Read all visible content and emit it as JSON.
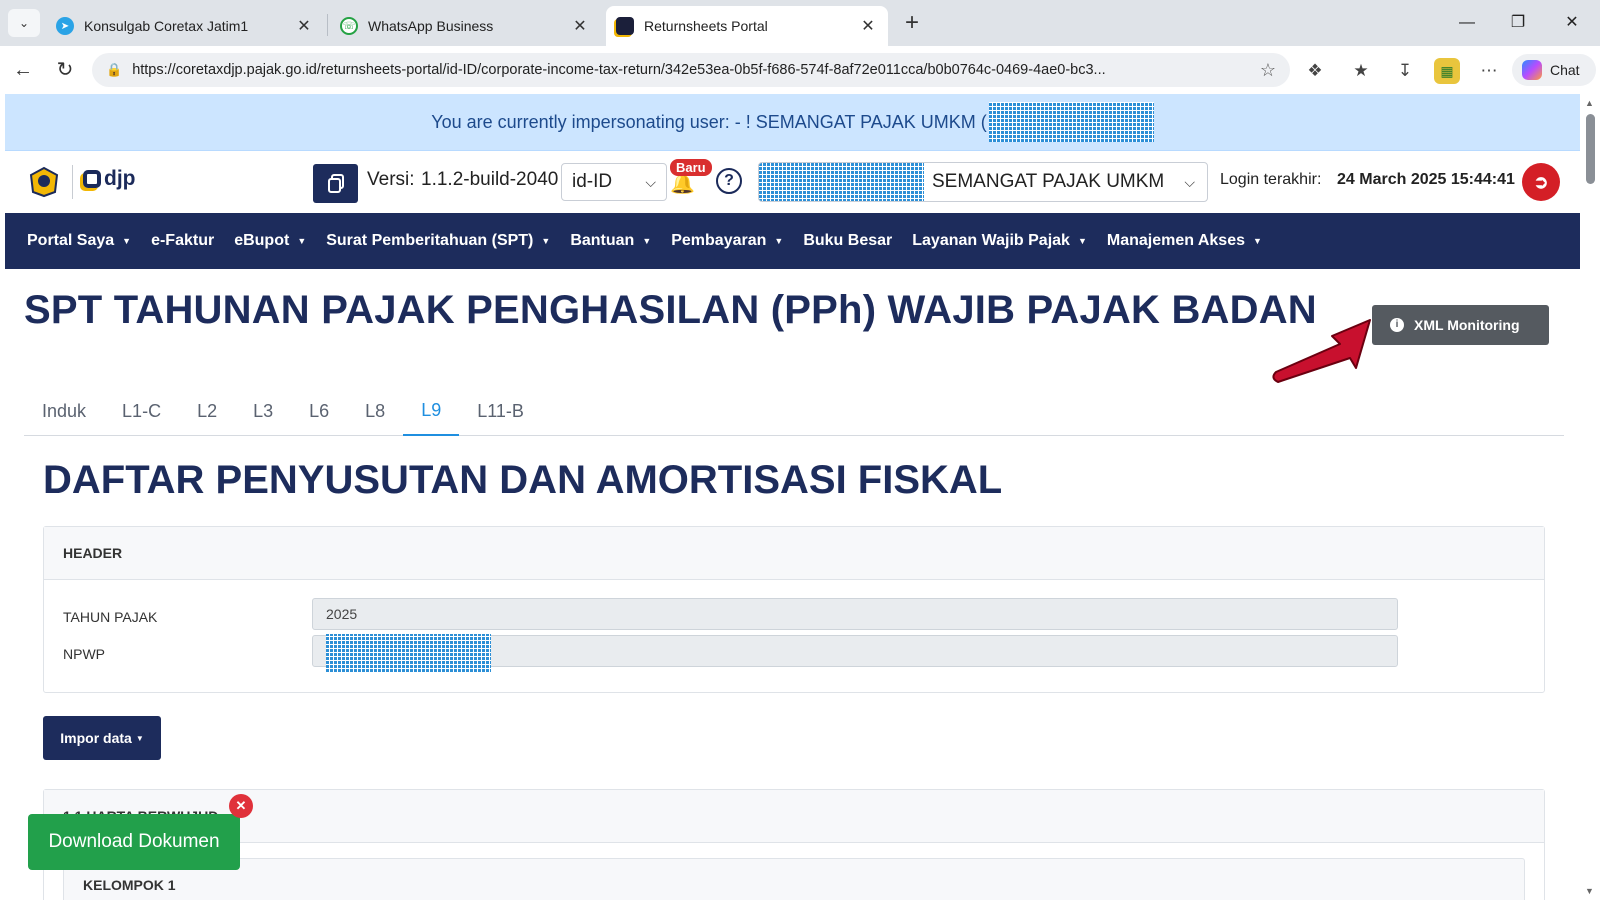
{
  "browser": {
    "tabs": [
      {
        "title": "Konsulgab Coretax Jatim1",
        "icon": "telegram-icon",
        "active": false
      },
      {
        "title": "WhatsApp Business",
        "icon": "whatsapp-icon",
        "active": false
      },
      {
        "title": "Returnsheets Portal",
        "icon": "portal-icon",
        "active": true
      }
    ],
    "url": "https://coretaxdjp.pajak.go.id/returnsheets-portal/id-ID/corporate-income-tax-return/342e53ea-0b5f-f686-574f-8af72e011cca/b0b0764c-0469-4ae0-bc3...",
    "chat_label": "Chat"
  },
  "banner": {
    "text": "You are currently impersonating user: - ! SEMANGAT PAJAK UMKM ("
  },
  "header": {
    "logo_text": "djp",
    "versi_label": "Versi:",
    "versi_value": "1.1.2-build-2040",
    "language": "id-ID",
    "badge": "Baru",
    "taxpayer_name": "SEMANGAT PAJAK UMKM",
    "login_label": "Login terakhir:",
    "login_value": "24 March 2025 15:44:41"
  },
  "nav": {
    "items": [
      {
        "label": "Portal Saya",
        "dropdown": true
      },
      {
        "label": "e-Faktur",
        "dropdown": false
      },
      {
        "label": "eBupot",
        "dropdown": true
      },
      {
        "label": "Surat Pemberitahuan (SPT)",
        "dropdown": true
      },
      {
        "label": "Bantuan",
        "dropdown": true
      },
      {
        "label": "Pembayaran",
        "dropdown": true
      },
      {
        "label": "Buku Besar",
        "dropdown": false
      },
      {
        "label": "Layanan Wajib Pajak",
        "dropdown": true
      },
      {
        "label": "Manajemen Akses",
        "dropdown": true
      }
    ]
  },
  "main": {
    "title": "SPT TAHUNAN PAJAK PENGHASILAN (PPh) WAJIB PAJAK BADAN",
    "xml_button": "XML Monitoring",
    "tabs": [
      "Induk",
      "L1-C",
      "L2",
      "L3",
      "L6",
      "L8",
      "L9",
      "L11-B"
    ],
    "active_tab": "L9",
    "section_title": "DAFTAR PENYUSUTAN DAN AMORTISASI FISKAL",
    "header_card": {
      "title": "HEADER",
      "tahun_label": "TAHUN PAJAK",
      "tahun_value": "2025",
      "npwp_label": "NPWP"
    },
    "impor_button": "Impor data",
    "harta_title": "1.1 HARTA BERWUJUD",
    "kelompok_title": "KELOMPOK 1",
    "download_button": "Download Dokumen"
  },
  "colors": {
    "navy": "#1d2c5c",
    "active_tab": "#1f8fe0",
    "download_green": "#22a04b",
    "logout_red": "#d41f26"
  }
}
